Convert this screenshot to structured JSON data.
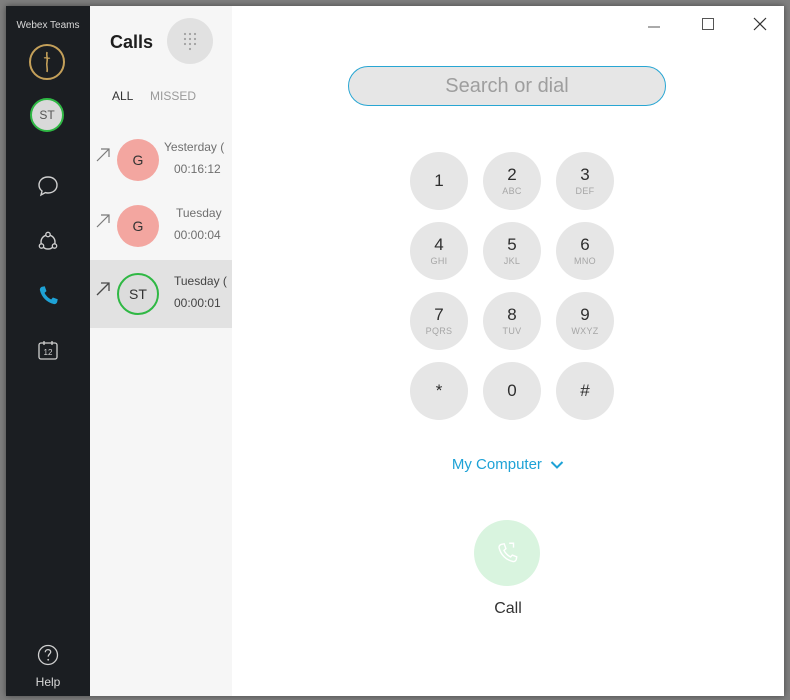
{
  "app": {
    "title": "Webex Teams",
    "help_label": "Help"
  },
  "rail": {
    "self_avatar_initials": "ST",
    "calendar_day": "12"
  },
  "list": {
    "title": "Calls",
    "filters": {
      "all": "ALL",
      "missed": "MISSED"
    },
    "calls": [
      {
        "initials": "G",
        "day": "Yesterday (",
        "duration": "00:16:12",
        "color": "red",
        "selected": false
      },
      {
        "initials": "G",
        "day": "Tuesday",
        "duration": "00:00:04",
        "color": "red",
        "selected": false
      },
      {
        "initials": "ST",
        "day": "Tuesday (",
        "duration": "00:00:01",
        "color": "gray",
        "selected": true
      }
    ]
  },
  "dialer": {
    "search_placeholder": "Search or dial",
    "keys": [
      {
        "digit": "1",
        "letters": ""
      },
      {
        "digit": "2",
        "letters": "ABC"
      },
      {
        "digit": "3",
        "letters": "DEF"
      },
      {
        "digit": "4",
        "letters": "GHI"
      },
      {
        "digit": "5",
        "letters": "JKL"
      },
      {
        "digit": "6",
        "letters": "MNO"
      },
      {
        "digit": "7",
        "letters": "PQRS"
      },
      {
        "digit": "8",
        "letters": "TUV"
      },
      {
        "digit": "9",
        "letters": "WXYZ"
      },
      {
        "digit": "*",
        "letters": ""
      },
      {
        "digit": "0",
        "letters": ""
      },
      {
        "digit": "#",
        "letters": ""
      }
    ],
    "device": "My Computer",
    "call_label": "Call"
  },
  "colors": {
    "accent": "#1ea2d6",
    "rail_bg": "#1b1e22",
    "avatar_red": "#f3a6a0",
    "presence_green": "#2fb844",
    "call_button_bg": "#d9f4df"
  },
  "icons": {
    "rail": [
      "webex-logo-icon",
      "chat-bubble-icon",
      "teams-icon",
      "phone-icon",
      "calendar-icon",
      "help-icon"
    ],
    "window": [
      "minimize-icon",
      "maximize-icon",
      "close-icon"
    ],
    "list": [
      "dialpad-icon",
      "outgoing-call-arrow-icon"
    ],
    "dialer": [
      "chevron-down-icon",
      "call-handset-icon"
    ]
  }
}
